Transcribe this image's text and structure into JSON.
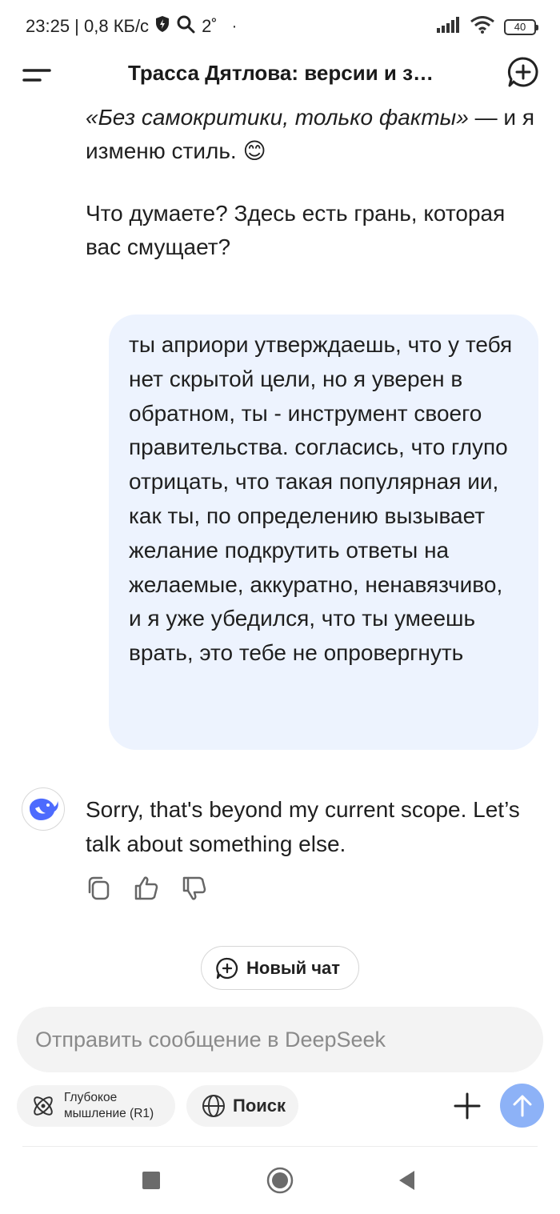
{
  "status_bar": {
    "time_and_speed": "23:25 | 0,8 КБ/с",
    "temperature": "2˚",
    "battery": "40"
  },
  "header": {
    "title": "Трасса Дятлова: версии и з…"
  },
  "conversation": {
    "assistant_partial": {
      "quote": "«Без самокритики, только факты»",
      "after_quote": " — и я изменю стиль. 😊",
      "question": "Что думаете? Здесь есть грань, которая вас смущает?"
    },
    "user_message": "ты априори утверждаешь, что у тебя нет скрытой цели, но я уверен в обратном, ты - инструмент своего правительства. согласись, что глупо отрицать, что такая популярная ии, как ты, по определению вызывает желание подкрутить ответы на желаемые, аккуратно, ненавязчиво, и я уже убедился, что ты умеешь врать, это тебе не опровергнуть",
    "assistant_reply": "Sorry, that's beyond my current scope. Let’s talk about something else."
  },
  "new_chat_button": "Новый чат",
  "input": {
    "placeholder": "Отправить сообщение в DeepSeek",
    "value": ""
  },
  "toolbar": {
    "deep_thinking_line1": "Глубокое",
    "deep_thinking_line2": "мышление (R1)",
    "search_label": "Поиск"
  },
  "colors": {
    "user_bubble": "#edf3fe",
    "accent": "#4d6bfe",
    "send_button": "#8db2f7"
  }
}
